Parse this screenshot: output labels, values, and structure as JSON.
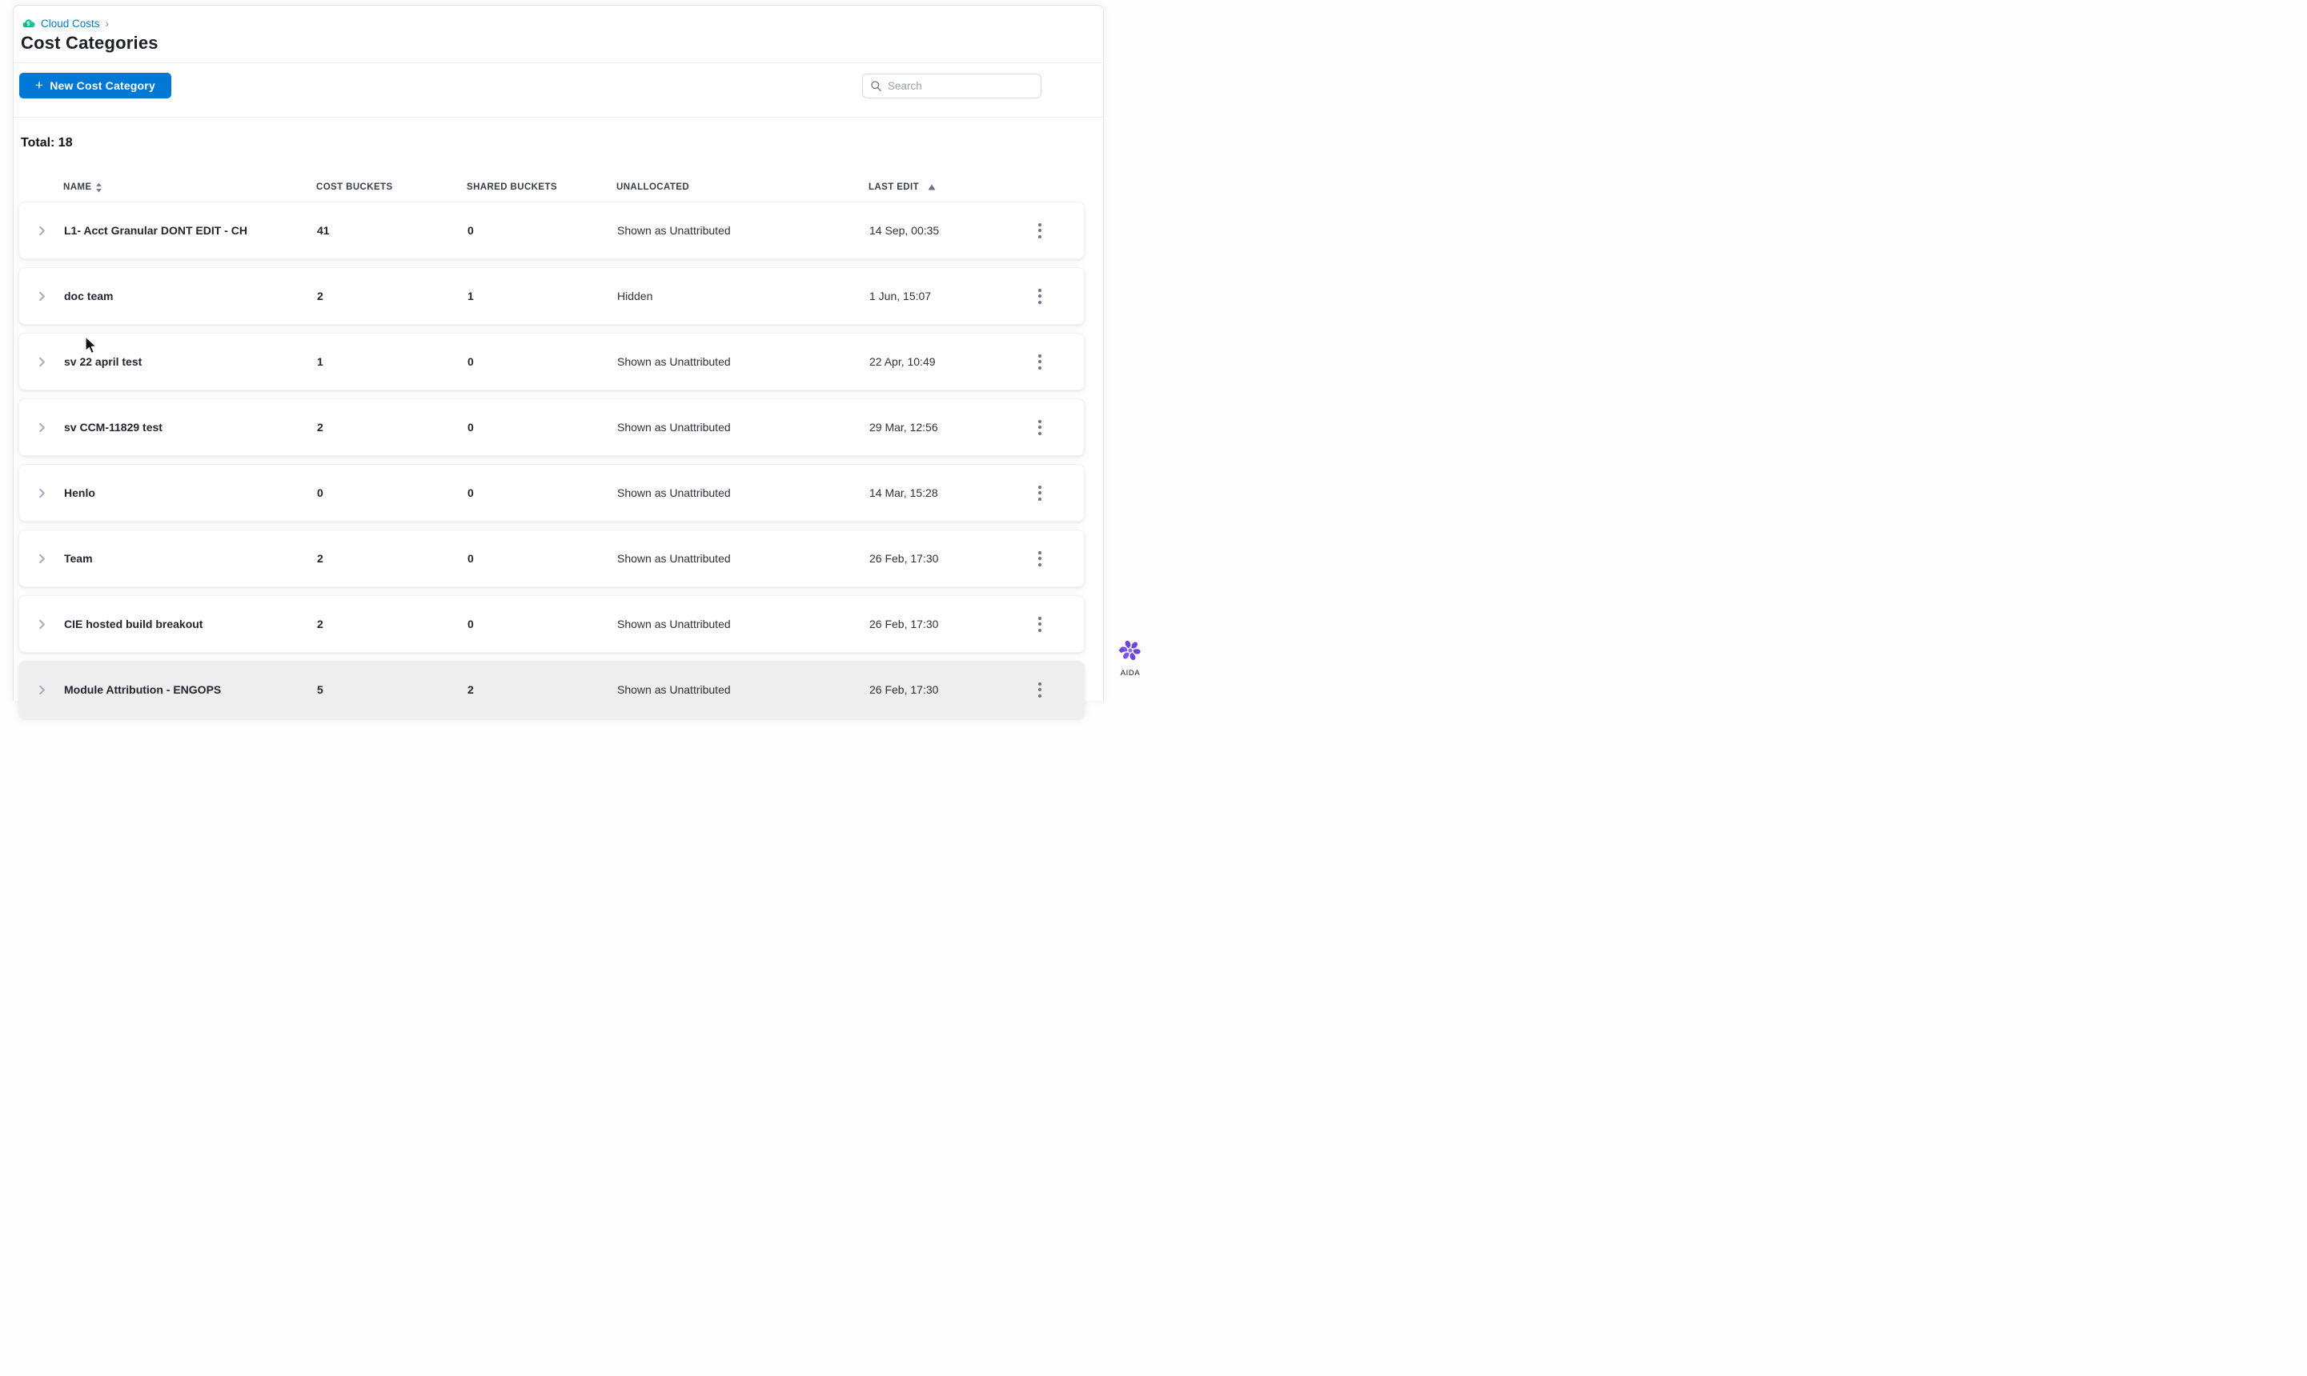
{
  "breadcrumb": {
    "label": "Cloud Costs",
    "separator": "›",
    "icon": "cloud-dollar-icon"
  },
  "page": {
    "title": "Cost Categories"
  },
  "toolbar": {
    "new_button_label": "New Cost Category",
    "plus_glyph": "+",
    "search_placeholder": "Search",
    "search_value": ""
  },
  "summary": {
    "total_label": "Total: 18"
  },
  "table": {
    "columns": [
      {
        "label": "NAME",
        "sort": "both"
      },
      {
        "label": "COST BUCKETS",
        "sort": "none"
      },
      {
        "label": "SHARED BUCKETS",
        "sort": "none"
      },
      {
        "label": "UNALLOCATED",
        "sort": "none"
      },
      {
        "label": "LAST EDIT",
        "sort": "asc"
      }
    ],
    "rows": [
      {
        "name": "L1- Acct Granular DONT EDIT - CH",
        "cost_buckets": "41",
        "shared_buckets": "0",
        "unallocated": "Shown as Unattributed",
        "last_edit": "14 Sep, 00:35"
      },
      {
        "name": "doc team",
        "cost_buckets": "2",
        "shared_buckets": "1",
        "unallocated": "Hidden",
        "last_edit": "1 Jun, 15:07"
      },
      {
        "name": "sv 22 april test",
        "cost_buckets": "1",
        "shared_buckets": "0",
        "unallocated": "Shown as Unattributed",
        "last_edit": "22 Apr, 10:49"
      },
      {
        "name": "sv CCM-11829 test",
        "cost_buckets": "2",
        "shared_buckets": "0",
        "unallocated": "Shown as Unattributed",
        "last_edit": "29 Mar, 12:56"
      },
      {
        "name": "Henlo",
        "cost_buckets": "0",
        "shared_buckets": "0",
        "unallocated": "Shown as Unattributed",
        "last_edit": "14 Mar, 15:28"
      },
      {
        "name": "Team",
        "cost_buckets": "2",
        "shared_buckets": "0",
        "unallocated": "Shown as Unattributed",
        "last_edit": "26 Feb, 17:30"
      },
      {
        "name": "CIE hosted build breakout",
        "cost_buckets": "2",
        "shared_buckets": "0",
        "unallocated": "Shown as Unattributed",
        "last_edit": "26 Feb, 17:30"
      },
      {
        "name": "Module Attribution - ENGOPS",
        "cost_buckets": "5",
        "shared_buckets": "2",
        "unallocated": "Shown as Unattributed",
        "last_edit": "26 Feb, 17:30",
        "partial": true
      }
    ]
  },
  "assistant": {
    "label": "AIDA"
  },
  "colors": {
    "primary_blue": "#0278D5",
    "link_blue": "#0278D5",
    "cloud_icon_teal": "#11C8A5",
    "aida_purple": "#6B46D9",
    "card_background": "#FFFFFF",
    "divider": "#E9EAEF"
  }
}
